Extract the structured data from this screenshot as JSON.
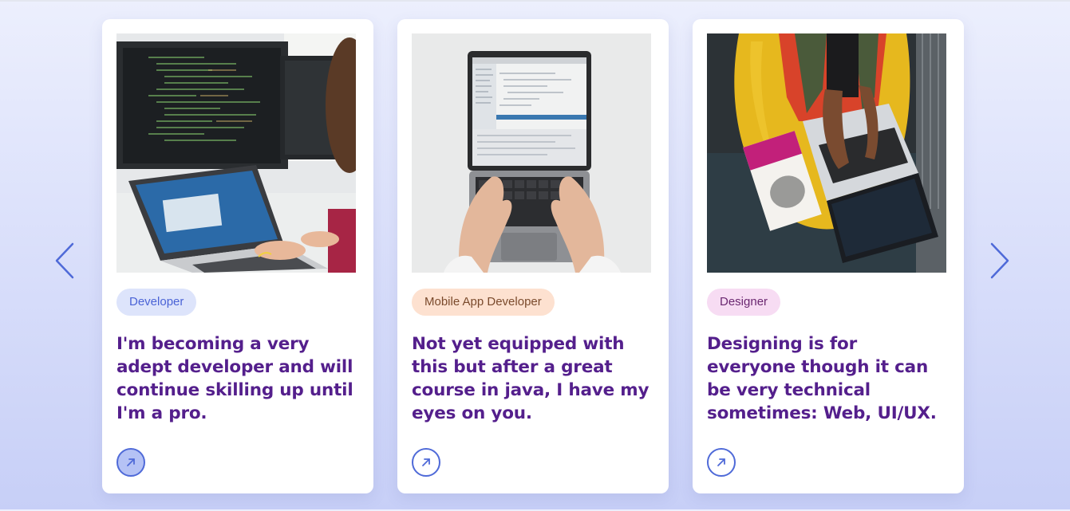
{
  "carousel": {
    "prev_icon": "chevron-left-icon",
    "next_icon": "chevron-right-icon",
    "cards": [
      {
        "tag": "Developer",
        "title": "I'm becoming a very adept developer and will continue skilling up until I'm a pro.",
        "image": "developer-workstation-photo",
        "link_icon": "arrow-up-right-icon"
      },
      {
        "tag": "Mobile App Developer",
        "title": "Not yet equipped with this but after a great course in java, I have my eyes on you.",
        "image": "laptop-typing-photo",
        "link_icon": "arrow-up-right-icon"
      },
      {
        "tag": "Designer",
        "title": "Designing is for everyone though it can be very technical sometimes: Web, UI/UX.",
        "image": "designer-laptop-python-book-photo",
        "link_icon": "arrow-up-right-icon"
      }
    ]
  },
  "colors": {
    "accent": "#4f6ad8",
    "title": "#541f8c",
    "developer_tag_bg": "#dde4fb",
    "mobile_tag_bg": "#fde1d0",
    "designer_tag_bg": "#f7dcf3"
  }
}
